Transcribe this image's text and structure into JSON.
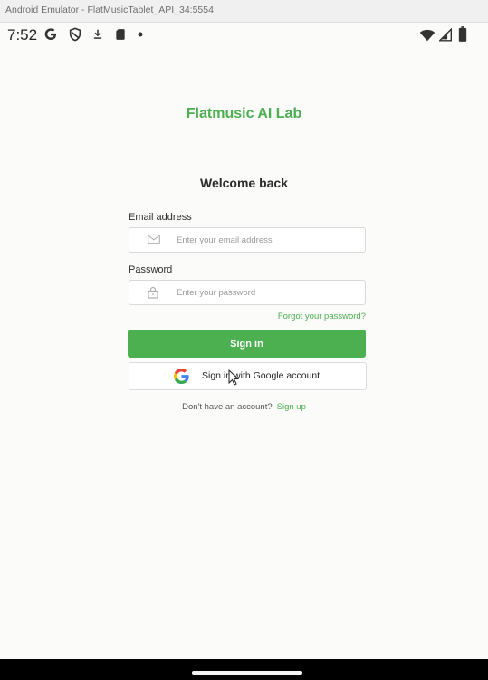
{
  "window": {
    "title": "Android Emulator - FlatMusicTablet_API_34:5554"
  },
  "statusbar": {
    "time": "7:52",
    "left_icons": [
      "google-icon",
      "shield-icon",
      "download-icon",
      "sd-card-icon",
      "dot-icon"
    ],
    "right_icons": [
      "wifi-icon",
      "cell-signal-icon",
      "battery-icon"
    ]
  },
  "app": {
    "title": "Flatmusic AI Lab",
    "title_color": "#4caf50"
  },
  "login": {
    "heading": "Welcome back",
    "email_label": "Email address",
    "email_placeholder": "Enter your email address",
    "email_icon": "mail-icon",
    "password_label": "Password",
    "password_placeholder": "Enter your password",
    "password_icon": "lock-icon",
    "forgot_password": "Forgot your password?",
    "signin_button": "Sign in",
    "google_button": "Sign in with Google account",
    "no_account_text": "Don't have an account?",
    "signup_link": "Sign up",
    "accent_color": "#4caf50"
  }
}
